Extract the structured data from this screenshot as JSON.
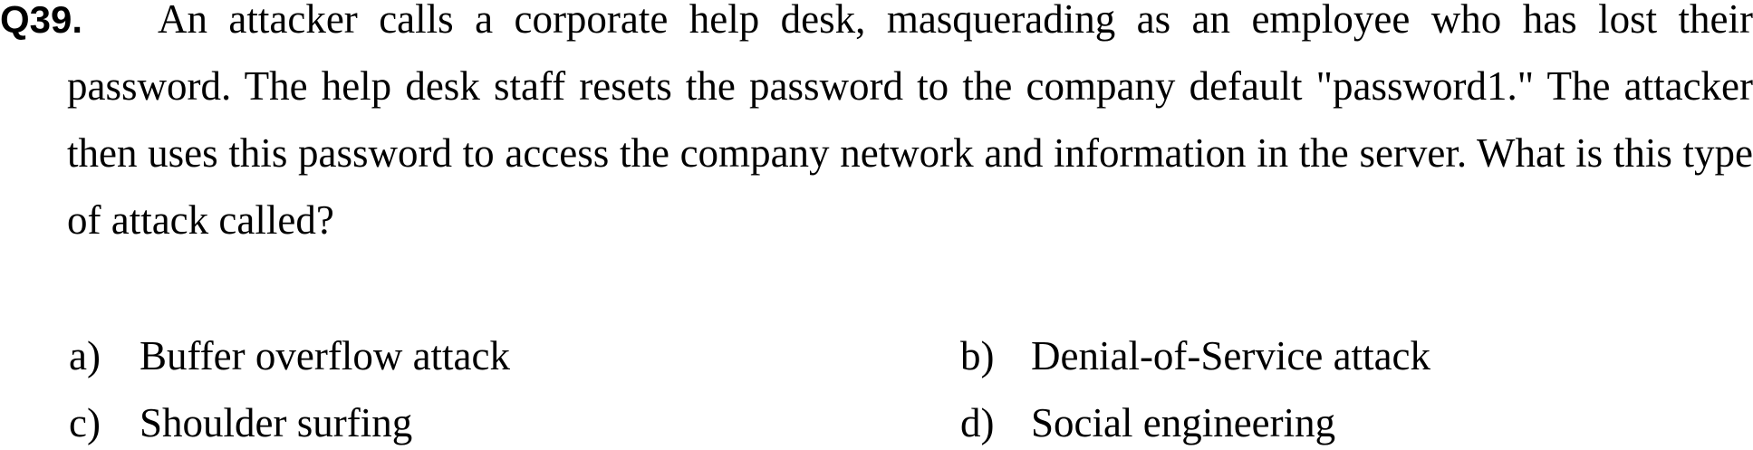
{
  "question": {
    "number": "Q39.",
    "text": "An attacker calls a corporate help desk, masquerading as an employee who has lost their password. The help desk staff resets the password to the company default \"password1.\" The attacker then uses this password to access the company network and information in the server. What is this type of attack called?"
  },
  "options": [
    {
      "letter": "a)",
      "text": "Buffer overflow attack"
    },
    {
      "letter": "b)",
      "text": "Denial-of-Service attack"
    },
    {
      "letter": "c)",
      "text": "Shoulder surfing"
    },
    {
      "letter": "d)",
      "text": "Social engineering"
    }
  ]
}
